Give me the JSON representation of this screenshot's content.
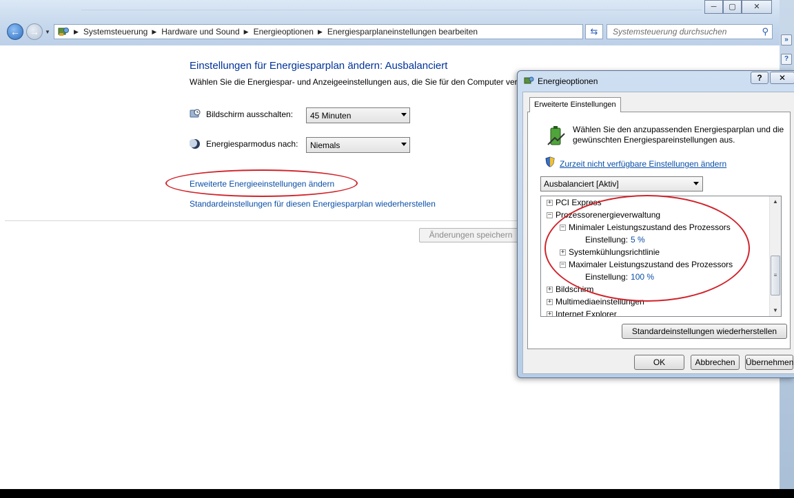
{
  "explorer": {
    "breadcrumb": [
      "Systemsteuerung",
      "Hardware und Sound",
      "Energieoptionen",
      "Energiesparplaneinstellungen bearbeiten"
    ],
    "search_placeholder": "Systemsteuerung durchsuchen",
    "window_buttons": {
      "minimize": "─",
      "maximize": "▢",
      "close": "✕"
    }
  },
  "page": {
    "title": "Einstellungen für Energiesparplan ändern: Ausbalanciert",
    "subtitle": "Wählen Sie die Energiespar- und Anzeigeeinstellungen aus, die Sie für den Computer verwenden möchten.",
    "settings": [
      {
        "label": "Bildschirm ausschalten:",
        "value": "45 Minuten",
        "icon": "monitor-clock-icon"
      },
      {
        "label": "Energiesparmodus nach:",
        "value": "Niemals",
        "icon": "moon-icon"
      }
    ],
    "advanced_link": "Erweiterte Energieeinstellungen ändern",
    "restore_link": "Standardeinstellungen für diesen Energiesparplan wiederherstellen",
    "save_button": "Änderungen speichern"
  },
  "dialog": {
    "title": "Energieoptionen",
    "help_button": "?",
    "close_button": "✕",
    "tab_label": "Erweiterte Einstellungen",
    "description": "Wählen Sie den anzupassenden Energiesparplan und die gewünschten Energiespareinstellungen aus.",
    "unavailable_link": "Zurzeit nicht verfügbare Einstellungen ändern",
    "plan_select": "Ausbalanciert [Aktiv]",
    "tree": [
      {
        "label": "PCI Express",
        "expander": "+"
      },
      {
        "label": "Prozessorenergieverwaltung",
        "expander": "−"
      },
      {
        "label": "Minimaler Leistungszustand des Prozessors",
        "expander": "−"
      },
      {
        "label": "Einstellung:",
        "value": "5 %"
      },
      {
        "label": "Systemkühlungsrichtlinie",
        "expander": "+"
      },
      {
        "label": "Maximaler Leistungszustand des Prozessors",
        "expander": "−"
      },
      {
        "label": "Einstellung:",
        "value": "100 %"
      },
      {
        "label": "Bildschirm",
        "expander": "+"
      },
      {
        "label": "Multimediaeinstellungen",
        "expander": "+"
      },
      {
        "label": "Internet Explorer",
        "expander": "+"
      }
    ],
    "restore_defaults_button": "Standardeinstellungen wiederherstellen",
    "ok_button": "OK",
    "cancel_button": "Abbrechen",
    "apply_button": "Übernehmen"
  },
  "colors": {
    "link": "#0a4fa8",
    "annotation": "#d0232a",
    "title": "#003399"
  }
}
